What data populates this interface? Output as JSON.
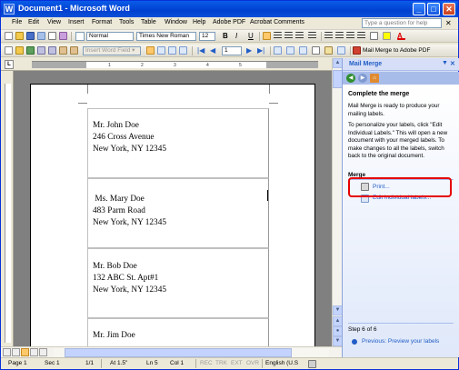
{
  "window": {
    "title": "Document1 - Microsoft Word",
    "app_icon_glyph": "W",
    "minimize_glyph": "_",
    "maximize_glyph": "□",
    "close_glyph": "✕"
  },
  "menu": [
    "File",
    "Edit",
    "View",
    "Insert",
    "Format",
    "Tools",
    "Table",
    "Window",
    "Help",
    "Adobe PDF",
    "Acrobat Comments"
  ],
  "help_search": {
    "placeholder": "Type a question for help",
    "close_glyph": "✕"
  },
  "formatting_toolbar": {
    "style": "Normal",
    "font": "Times New Roman",
    "size": "12",
    "bold": "B",
    "italic": "I",
    "underline": "U",
    "font_color_glyph": "A"
  },
  "mail_merge_toolbar": {
    "insert_word_field": "Insert Word Field ▾",
    "record_number": "1",
    "merge_to_adobe_pdf": "Mail Merge to Adobe PDF"
  },
  "ruler": {
    "corner_glyph": "L",
    "numbers": [
      "1",
      "2",
      "3",
      "4",
      "5"
    ]
  },
  "labels": [
    {
      "lines": [
        "Mr. John Doe",
        "246 Cross Avenue",
        "New York, NY 12345"
      ]
    },
    {
      "lines": [
        " Ms. Mary Doe",
        "483 Parm Road",
        "New York, NY 12345"
      ]
    },
    {
      "lines": [
        "Mr. Bob Doe",
        "132 ABC St. Apt#1",
        "New York, NY 12345"
      ]
    },
    {
      "lines": [
        "Mr. Jim Doe"
      ]
    }
  ],
  "task_pane": {
    "title": "Mail Merge",
    "dropdown_glyph": "▼",
    "close_glyph": "✕",
    "heading": "Complete the merge",
    "intro": "Mail Merge is ready to produce your mailing labels.",
    "personalize": "To personalize your labels, click \"Edit Individual Labels.\" This will open a new document with your merged labels. To make changes to all the labels, switch back to the original document.",
    "merge_heading": "Merge",
    "print_link": "Print...",
    "edit_link": "Edit individual labels...",
    "step": "Step 6 of 6",
    "previous_link": "Previous: Preview your labels"
  },
  "status_bar": {
    "page": "Page  1",
    "sec": "Sec  1",
    "page_of": "1/1",
    "at": "At  1.5\"",
    "ln": "Ln  5",
    "col": "Col  1",
    "rec": "REC",
    "trk": "TRK",
    "ext": "EXT",
    "ovr": "OVR",
    "language": "English (U.S"
  },
  "colors": {
    "titlebar": "#0a5ce8",
    "task_pane_link": "#215dc6",
    "highlight_box": "#e60000",
    "ui_face": "#ece9d8"
  }
}
